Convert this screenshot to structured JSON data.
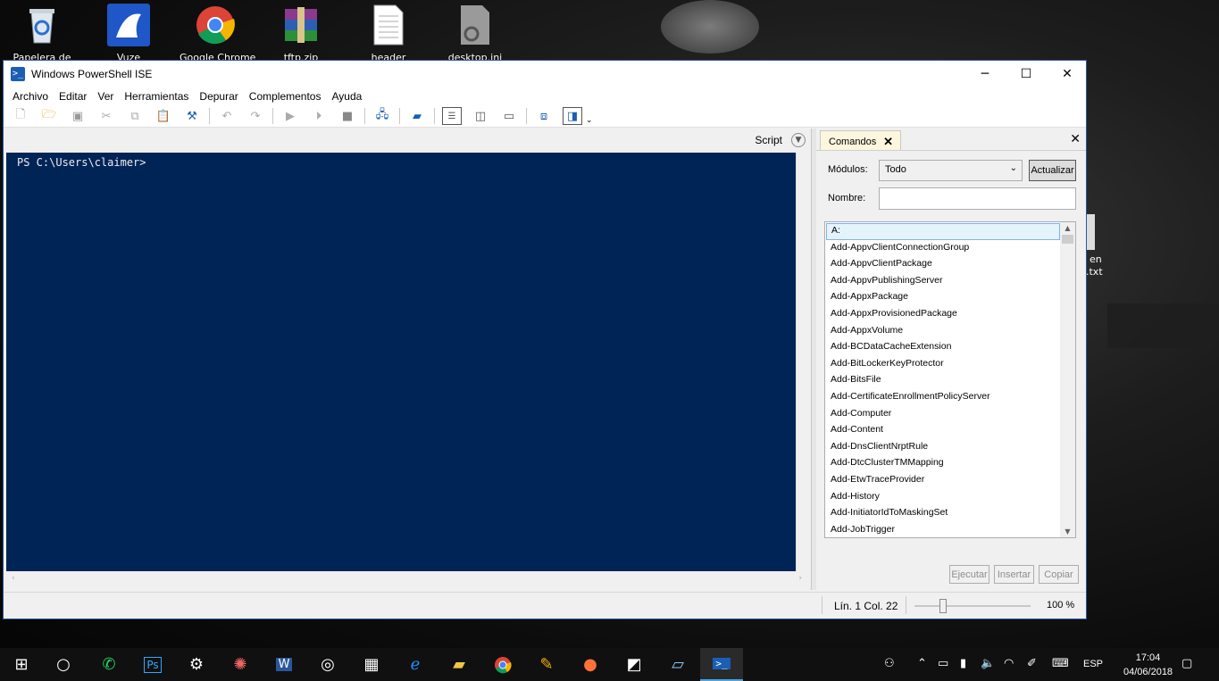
{
  "desktop": {
    "icons": [
      {
        "label": "Papelera de",
        "icon": "recycle-bin-icon"
      },
      {
        "label": "Vuze",
        "icon": "vuze-frog-icon"
      },
      {
        "label": "Google Chrome",
        "icon": "chrome-icon"
      },
      {
        "label": "tftp.zip",
        "icon": "winrar-archive-icon"
      },
      {
        "label": "header",
        "icon": "text-file-icon"
      },
      {
        "label": "desktop.ini",
        "icon": "settings-file-icon"
      }
    ],
    "partial_icon": {
      "line1": "en",
      "line2": ".txt"
    }
  },
  "window": {
    "title": "Windows PowerShell ISE",
    "controls": {
      "minimize": "─",
      "maximize": "☐",
      "close": "✕"
    },
    "menu": [
      "Archivo",
      "Editar",
      "Ver",
      "Herramientas",
      "Depurar",
      "Complementos",
      "Ayuda"
    ],
    "toolbar_icons": [
      "new-file-icon",
      "open-folder-icon",
      "save-icon",
      "cut-icon",
      "copy-icon",
      "paste-icon",
      "clear-console-icon",
      "undo-icon",
      "redo-icon",
      "run-icon",
      "run-selection-icon",
      "stop-icon",
      "remote-powershell-icon",
      "powershell-console-icon",
      "layout-top-icon",
      "layout-right-icon",
      "layout-max-icon",
      "show-commands-icon",
      "show-script-icon",
      "toolbar-overflow-icon"
    ],
    "script_label": "Script",
    "console_prompt": "PS C:\\Users\\claimer>",
    "commands": {
      "tab_label": "Comandos",
      "modules_label": "Módulos:",
      "modules_value": "Todo",
      "refresh_button": "Actualizar",
      "name_label": "Nombre:",
      "name_value": "",
      "items": [
        "A:",
        "Add-AppvClientConnectionGroup",
        "Add-AppvClientPackage",
        "Add-AppvPublishingServer",
        "Add-AppxPackage",
        "Add-AppxProvisionedPackage",
        "Add-AppxVolume",
        "Add-BCDataCacheExtension",
        "Add-BitLockerKeyProtector",
        "Add-BitsFile",
        "Add-CertificateEnrollmentPolicyServer",
        "Add-Computer",
        "Add-Content",
        "Add-DnsClientNrptRule",
        "Add-DtcClusterTMMapping",
        "Add-EtwTraceProvider",
        "Add-History",
        "Add-InitiatorIdToMaskingSet",
        "Add-JobTrigger"
      ],
      "buttons": {
        "run": "Ejecutar",
        "insert": "Insertar",
        "copy": "Copiar"
      }
    },
    "status": {
      "line": "Lín. 1",
      "col": "Col. 22",
      "zoom": "100 %"
    }
  },
  "taskbar": {
    "apps": [
      "start-icon",
      "cortana-icon",
      "whatsapp-icon",
      "photoshop-icon",
      "settings-icon",
      "app-icon",
      "word-icon",
      "app-ring-icon",
      "calculator-icon",
      "edge-icon",
      "file-explorer-icon",
      "chrome-icon",
      "paint-icon",
      "firefox-icon",
      "sticky-notes-icon",
      "notepad-icon",
      "powershell-ise-icon"
    ],
    "tray_language": "ESP",
    "time": "17:04",
    "date": "04/06/2018"
  }
}
